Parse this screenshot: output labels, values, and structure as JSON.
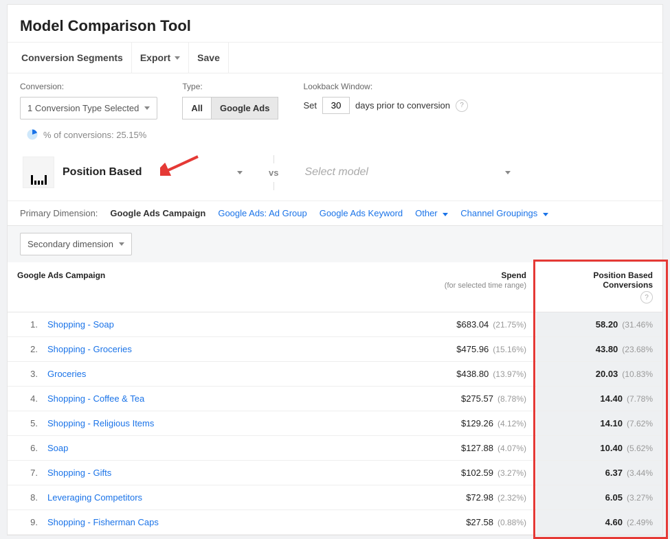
{
  "header": {
    "title": "Model Comparison Tool",
    "toolbar": {
      "conversion_segments": "Conversion Segments",
      "export": "Export",
      "save": "Save"
    }
  },
  "controls": {
    "conversion_label": "Conversion:",
    "conversion_value": "1 Conversion Type Selected",
    "type_label": "Type:",
    "type_all": "All",
    "type_google_ads": "Google Ads",
    "lookback_label": "Lookback Window:",
    "lookback_set": "Set",
    "lookback_days_value": "30",
    "lookback_suffix": "days prior to conversion",
    "pct_conversions_label": "% of conversions: 25.15%"
  },
  "models": {
    "selected_name": "Position Based",
    "vs": "vs",
    "placeholder": "Select model"
  },
  "dimensions": {
    "label": "Primary Dimension:",
    "tabs": [
      {
        "label": "Google Ads Campaign",
        "active": true
      },
      {
        "label": "Google Ads: Ad Group",
        "active": false
      },
      {
        "label": "Google Ads Keyword",
        "active": false
      },
      {
        "label": "Other",
        "active": false,
        "dropdown": true
      },
      {
        "label": "Channel Groupings",
        "active": false,
        "dropdown": true
      }
    ],
    "secondary_label": "Secondary dimension"
  },
  "table": {
    "headers": {
      "campaign": "Google Ads Campaign",
      "spend": "Spend",
      "spend_sub": "(for selected time range)",
      "conversions": "Position Based Conversions"
    },
    "rows": [
      {
        "n": "1.",
        "campaign": "Shopping - Soap",
        "spend": "$683.04",
        "spend_pct": "(21.75%)",
        "conv": "58.20",
        "conv_pct": "(31.46%"
      },
      {
        "n": "2.",
        "campaign": "Shopping - Groceries",
        "spend": "$475.96",
        "spend_pct": "(15.16%)",
        "conv": "43.80",
        "conv_pct": "(23.68%"
      },
      {
        "n": "3.",
        "campaign": "Groceries",
        "spend": "$438.80",
        "spend_pct": "(13.97%)",
        "conv": "20.03",
        "conv_pct": "(10.83%"
      },
      {
        "n": "4.",
        "campaign": "Shopping - Coffee & Tea",
        "spend": "$275.57",
        "spend_pct": "(8.78%)",
        "conv": "14.40",
        "conv_pct": "(7.78%"
      },
      {
        "n": "5.",
        "campaign": "Shopping - Religious Items",
        "spend": "$129.26",
        "spend_pct": "(4.12%)",
        "conv": "14.10",
        "conv_pct": "(7.62%"
      },
      {
        "n": "6.",
        "campaign": "Soap",
        "spend": "$127.88",
        "spend_pct": "(4.07%)",
        "conv": "10.40",
        "conv_pct": "(5.62%"
      },
      {
        "n": "7.",
        "campaign": "Shopping - Gifts",
        "spend": "$102.59",
        "spend_pct": "(3.27%)",
        "conv": "6.37",
        "conv_pct": "(3.44%"
      },
      {
        "n": "8.",
        "campaign": "Leveraging Competitors",
        "spend": "$72.98",
        "spend_pct": "(2.32%)",
        "conv": "6.05",
        "conv_pct": "(3.27%"
      },
      {
        "n": "9.",
        "campaign": "Shopping - Fisherman Caps",
        "spend": "$27.58",
        "spend_pct": "(0.88%)",
        "conv": "4.60",
        "conv_pct": "(2.49%"
      }
    ]
  }
}
